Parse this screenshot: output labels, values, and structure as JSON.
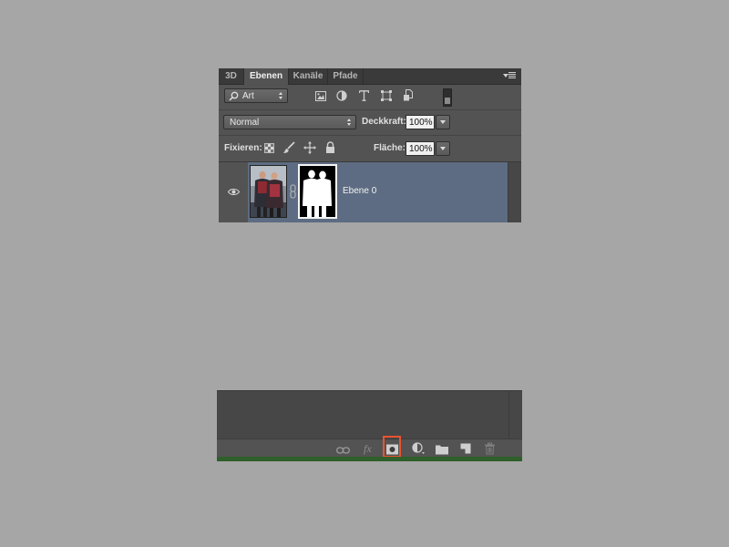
{
  "tabs": [
    {
      "label": "3D",
      "active": false
    },
    {
      "label": "Ebenen",
      "active": true
    },
    {
      "label": "Kanäle",
      "active": false
    },
    {
      "label": "Pfade",
      "active": false
    }
  ],
  "filter": {
    "kind_value": "Art",
    "icons": [
      "pixel-filter-icon",
      "adjustment-filter-icon",
      "type-filter-icon",
      "shape-filter-icon",
      "smart-object-filter-icon",
      "filter-toggle-switch"
    ]
  },
  "blend": {
    "mode_value": "Normal",
    "opacity_label": "Deckkraft:",
    "opacity_value": "100%"
  },
  "lock": {
    "label": "Fixieren:",
    "icons": [
      "lock-transparent-pixels-icon",
      "lock-image-pixels-icon",
      "lock-position-icon",
      "lock-all-icon"
    ],
    "fill_label": "Fläche:",
    "fill_value": "100%"
  },
  "layers": [
    {
      "name": "Ebene 0",
      "visible": true,
      "has_mask": true,
      "selected": true
    }
  ],
  "bottom_toolbar": {
    "icons": [
      "link-layers-icon",
      "layer-style-fx-icon",
      "add-mask-icon",
      "adjustment-layer-icon",
      "new-group-folder-icon",
      "new-layer-icon",
      "delete-layer-trash-icon"
    ],
    "fx_label": "fx",
    "highlighted": "add-mask-icon"
  },
  "colors": {
    "background": "#a6a6a6",
    "panel": "#535353",
    "selected_row": "#5d6c82",
    "highlight": "#e8532f"
  }
}
